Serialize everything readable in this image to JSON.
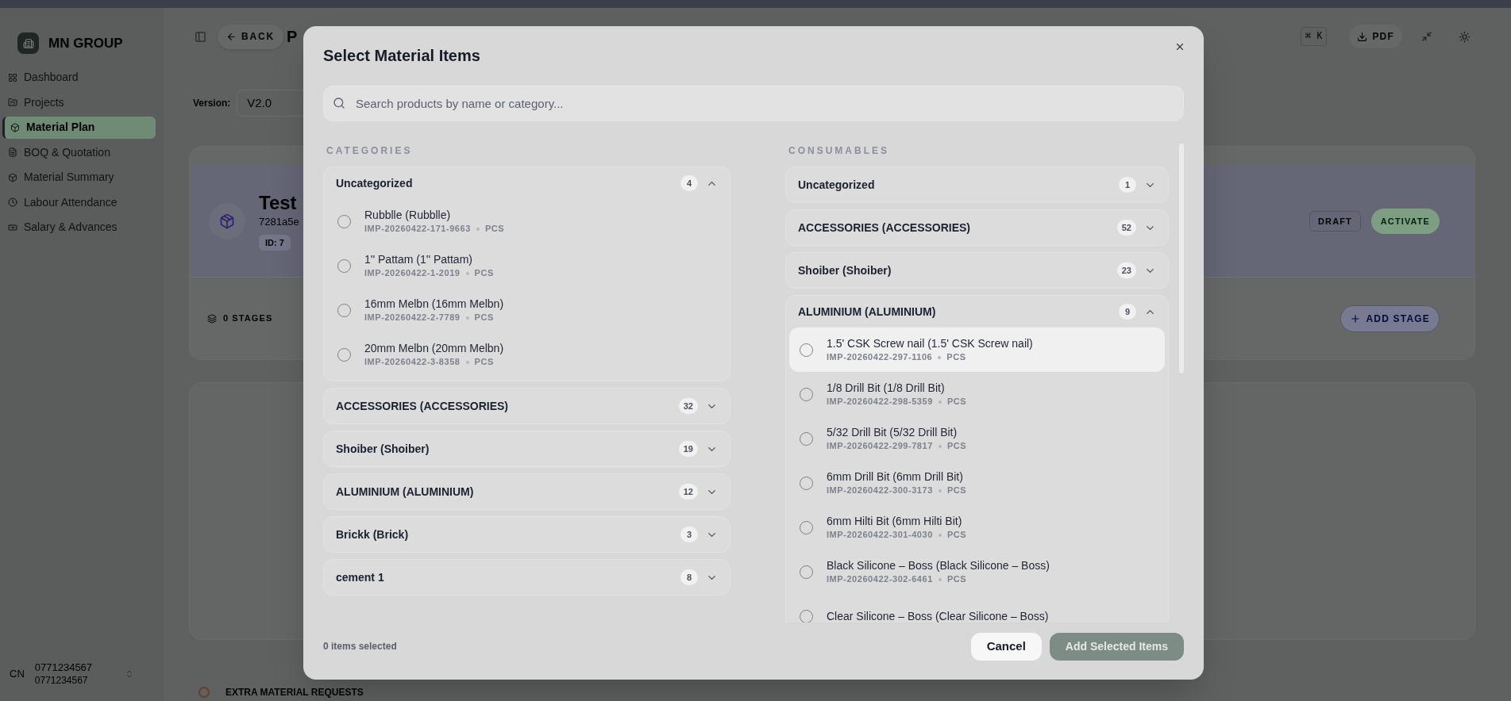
{
  "sidebar": {
    "brand": "MN GROUP",
    "items": [
      {
        "label": "Dashboard",
        "selected": false
      },
      {
        "label": "Projects",
        "selected": false
      },
      {
        "label": "Material Plan",
        "selected": true
      },
      {
        "label": "BOQ & Quotation",
        "selected": false
      },
      {
        "label": "Material Summary",
        "selected": false
      },
      {
        "label": "Labour Attendance",
        "selected": false
      },
      {
        "label": "Salary & Advances",
        "selected": false
      }
    ],
    "user": {
      "initials": "CN",
      "name": "0771234567",
      "subtitle": "0771234567"
    }
  },
  "header": {
    "back": "BACK",
    "title": "P",
    "shortcut": "⌘ K",
    "pdf": "PDF"
  },
  "version": {
    "label": "Version:",
    "value": "V2.0"
  },
  "plan_card": {
    "title": "Test",
    "code": "7281a5e",
    "id": "ID: 7",
    "status": "DRAFT",
    "activate": "ACTIVATE"
  },
  "stages": {
    "count": "0 STAGES",
    "add": "ADD STAGE"
  },
  "extra_requests": "EXTRA MATERIAL REQUESTS",
  "dialog": {
    "title": "Select Material Items",
    "search_placeholder": "Search products by name or category...",
    "columns": [
      {
        "heading": "CATEGORIES",
        "groups": [
          {
            "name": "Uncategorized",
            "count": "4",
            "expanded": true,
            "items": [
              {
                "name": "Rubblle (Rubblle)",
                "code": "IMP-20260422-171-9663",
                "unit": "PCS",
                "selected": false,
                "hovered": false
              },
              {
                "name": "1'' Pattam (1'' Pattam)",
                "code": "IMP-20260422-1-2019",
                "unit": "PCS",
                "selected": false,
                "hovered": false
              },
              {
                "name": "16mm Melbn (16mm Melbn)",
                "code": "IMP-20260422-2-7789",
                "unit": "PCS",
                "selected": false,
                "hovered": false
              },
              {
                "name": "20mm Melbn (20mm Melbn)",
                "code": "IMP-20260422-3-8358",
                "unit": "PCS",
                "selected": false,
                "hovered": false
              }
            ]
          },
          {
            "name": "ACCESSORIES (ACCESSORIES)",
            "count": "32",
            "expanded": false
          },
          {
            "name": "Shoiber (Shoiber)",
            "count": "19",
            "expanded": false
          },
          {
            "name": "ALUMINIUM (ALUMINIUM)",
            "count": "12",
            "expanded": false
          },
          {
            "name": "Brickk (Brick)",
            "count": "3",
            "expanded": false
          },
          {
            "name": "cement 1",
            "count": "8",
            "expanded": false
          }
        ]
      },
      {
        "heading": "CONSUMABLES",
        "groups": [
          {
            "name": "Uncategorized",
            "count": "1",
            "expanded": false
          },
          {
            "name": "ACCESSORIES (ACCESSORIES)",
            "count": "52",
            "expanded": false
          },
          {
            "name": "Shoiber (Shoiber)",
            "count": "23",
            "expanded": false
          },
          {
            "name": "ALUMINIUM (ALUMINIUM)",
            "count": "9",
            "expanded": true,
            "items": [
              {
                "name": "1.5' CSK Screw nail (1.5' CSK Screw nail)",
                "code": "IMP-20260422-297-1106",
                "unit": "PCS",
                "selected": false,
                "hovered": true
              },
              {
                "name": "1/8 Drill Bit (1/8 Drill Bit)",
                "code": "IMP-20260422-298-5359",
                "unit": "PCS",
                "selected": false,
                "hovered": false
              },
              {
                "name": "5/32 Drill Bit (5/32 Drill Bit)",
                "code": "IMP-20260422-299-7817",
                "unit": "PCS",
                "selected": false,
                "hovered": false
              },
              {
                "name": "6mm Drill Bit (6mm Drill Bit)",
                "code": "IMP-20260422-300-3173",
                "unit": "PCS",
                "selected": false,
                "hovered": false
              },
              {
                "name": "6mm Hilti Bit (6mm Hilti Bit)",
                "code": "IMP-20260422-301-4030",
                "unit": "PCS",
                "selected": false,
                "hovered": false
              },
              {
                "name": "Black Silicone – Boss (Black Silicone – Boss)",
                "code": "IMP-20260422-302-6461",
                "unit": "PCS",
                "selected": false,
                "hovered": false
              },
              {
                "name": "Clear Silicone – Boss (Clear Silicone – Boss)",
                "selected": false,
                "hovered": false
              }
            ]
          }
        ]
      }
    ],
    "selected_count": "0 items selected",
    "cancel": "Cancel",
    "confirm": {
      "label": "Add Selected Items",
      "disabled": true
    }
  }
}
